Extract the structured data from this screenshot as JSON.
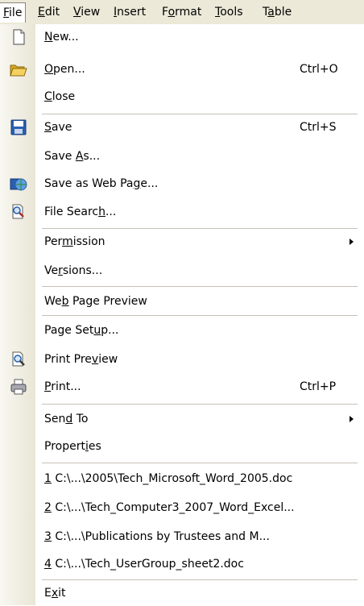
{
  "menubar": {
    "file": {
      "pre": "",
      "u": "F",
      "post": "ile"
    },
    "edit": {
      "pre": "",
      "u": "E",
      "post": "dit"
    },
    "view": {
      "pre": "",
      "u": "V",
      "post": "iew"
    },
    "insert": {
      "pre": "",
      "u": "I",
      "post": "nsert"
    },
    "format": {
      "pre": "F",
      "u": "o",
      "post": "rmat"
    },
    "tools": {
      "pre": "",
      "u": "T",
      "post": "ools"
    },
    "table": {
      "pre": "T",
      "u": "a",
      "post": "ble"
    }
  },
  "menu": {
    "new": {
      "pre": "",
      "u": "N",
      "post": "ew..."
    },
    "open": {
      "pre": "",
      "u": "O",
      "post": "pen...",
      "shortcut": "Ctrl+O"
    },
    "close": {
      "pre": "",
      "u": "C",
      "post": "lose"
    },
    "save": {
      "pre": "",
      "u": "S",
      "post": "ave",
      "shortcut": "Ctrl+S"
    },
    "save_as": {
      "pre": "Save ",
      "u": "A",
      "post": "s..."
    },
    "save_web": {
      "pre": "Save as Web Pa",
      "u": "g",
      "post": "e..."
    },
    "file_search": {
      "pre": "File Searc",
      "u": "h",
      "post": "..."
    },
    "permission": {
      "pre": "Per",
      "u": "m",
      "post": "ission"
    },
    "versions": {
      "pre": "Ve",
      "u": "r",
      "post": "sions..."
    },
    "web_preview": {
      "pre": "We",
      "u": "b",
      "post": " Page Preview"
    },
    "page_setup": {
      "pre": "Page Set",
      "u": "u",
      "post": "p..."
    },
    "print_preview": {
      "pre": "Print Pre",
      "u": "v",
      "post": "iew"
    },
    "print": {
      "pre": "",
      "u": "P",
      "post": "rint...",
      "shortcut": "Ctrl+P"
    },
    "send_to": {
      "pre": "Sen",
      "u": "d",
      "post": " To"
    },
    "properties": {
      "pre": "Propert",
      "u": "i",
      "post": "es"
    },
    "recent1": {
      "pre": "",
      "u": "1",
      "post": " C:\\...\\2005\\Tech_Microsoft_Word_2005.doc"
    },
    "recent2": {
      "pre": "",
      "u": "2",
      "post": " C:\\...\\Tech_Computer3_2007_Word_Excel..."
    },
    "recent3": {
      "pre": "",
      "u": "3",
      "post": " C:\\...\\Publications by Trustees and M..."
    },
    "recent4": {
      "pre": "",
      "u": "4",
      "post": " C:\\...\\Tech_UserGroup_sheet2.doc"
    },
    "exit": {
      "pre": "E",
      "u": "x",
      "post": "it"
    }
  },
  "icons": {
    "new": "new-document-icon",
    "open": "open-folder-icon",
    "save": "floppy-disk-icon",
    "save_web": "save-as-web-page-icon",
    "file_search": "file-search-icon",
    "print_preview": "print-preview-icon",
    "print": "printer-icon"
  },
  "colors": {
    "menubar_bg": "#ece9d8",
    "gutter": "#e9e6d6",
    "separator": "#c5c2b2",
    "save_blue": "#2a5fb0",
    "folder_yellow": "#f0c040"
  }
}
